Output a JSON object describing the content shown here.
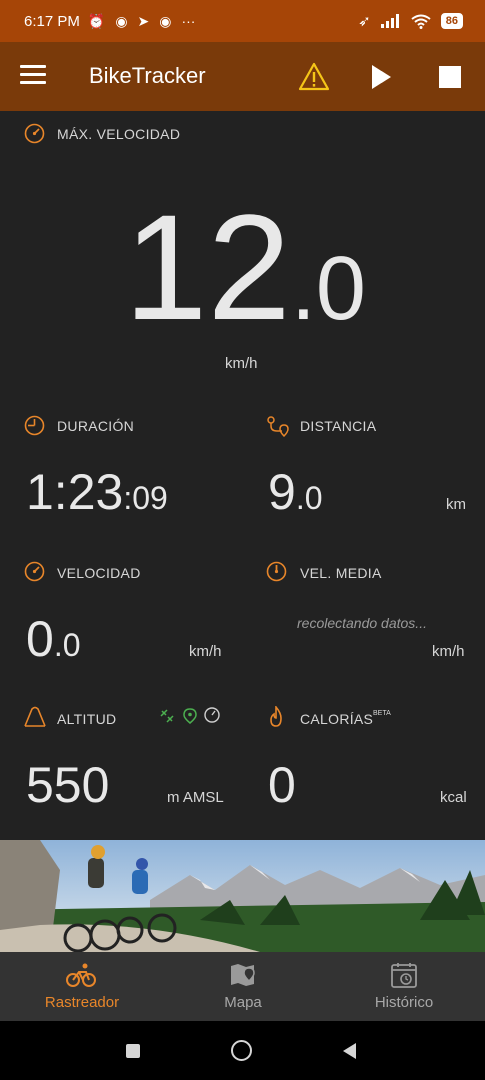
{
  "status_bar": {
    "time": "6:17 PM",
    "battery": "86"
  },
  "app": {
    "title": "BikeTracker"
  },
  "max_speed": {
    "label": "MÁX. VELOCIDAD",
    "int": "12",
    "dec": ".0",
    "unit": "km/h"
  },
  "duration": {
    "label": "DURACIÓN",
    "main": "1:23",
    "sec": ":09"
  },
  "distance": {
    "label": "DISTANCIA",
    "int": "9",
    "dec": ".0",
    "unit": "km"
  },
  "speed": {
    "label": "VELOCIDAD",
    "int": "0",
    "dec": ".0",
    "unit": "km/h"
  },
  "avg_speed": {
    "label": "VEL. MEDIA",
    "placeholder": "recolectando datos...",
    "unit": "km/h"
  },
  "altitude": {
    "label": "ALTITUD",
    "value": "550",
    "unit": "m AMSL"
  },
  "calories": {
    "label": "CALORÍAS",
    "badge": "BETA",
    "value": "0",
    "unit": "kcal"
  },
  "bottom_nav": [
    {
      "label": "Rastreador",
      "active": true
    },
    {
      "label": "Mapa",
      "active": false
    },
    {
      "label": "Histórico",
      "active": false
    }
  ],
  "colors": {
    "accent": "#e8862a",
    "statusbar": "#a64507",
    "appbar": "#7a3a0a",
    "background": "#222222",
    "green": "#4caf50"
  }
}
